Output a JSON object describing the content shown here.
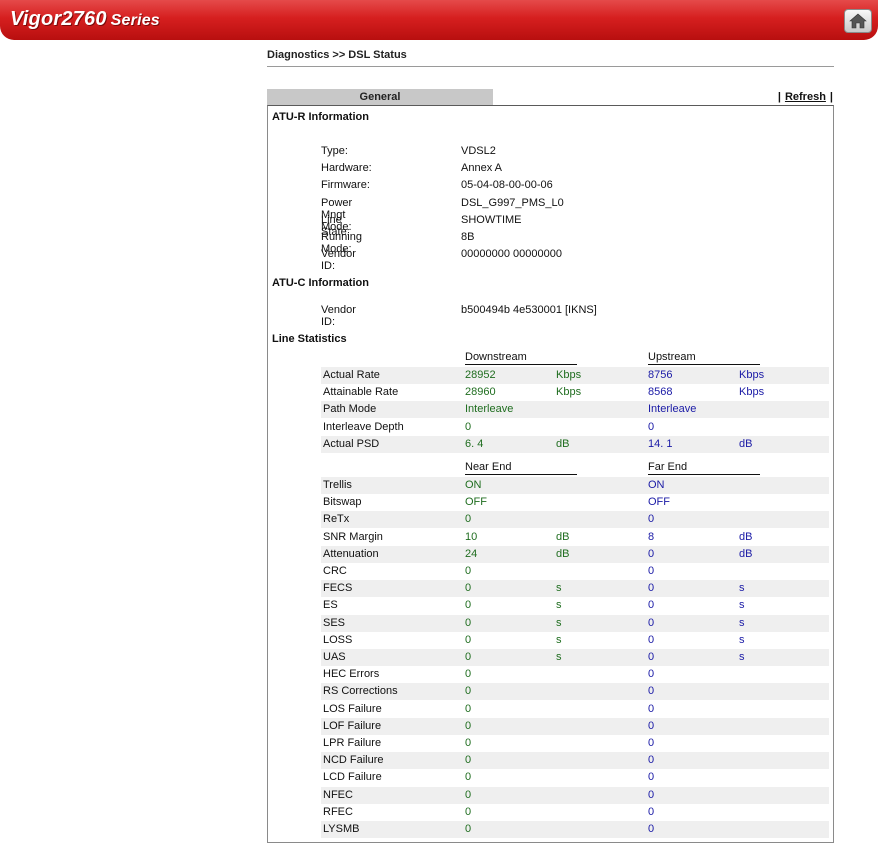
{
  "banner": {
    "model": "Vigor2760",
    "series": "Series"
  },
  "breadcrumb": "Diagnostics >> DSL Status",
  "tabs": {
    "general": "General"
  },
  "refresh": {
    "sep_left": "|",
    "label": "Refresh",
    "sep_right": "|"
  },
  "atur": {
    "title": "ATU-R Information",
    "rows": [
      {
        "label": "Type:",
        "value": "VDSL2"
      },
      {
        "label": "Hardware:",
        "value": "Annex A"
      },
      {
        "label": "Firmware:",
        "value": "05-04-08-00-00-06"
      },
      {
        "label": "Power Mngt Mode:",
        "value": "DSL_G997_PMS_L0"
      },
      {
        "label": "Line State:",
        "value": "SHOWTIME"
      },
      {
        "label": "Running Mode:",
        "value": "8B"
      },
      {
        "label": "Vendor ID:",
        "value": "00000000 00000000"
      }
    ]
  },
  "atuc": {
    "title": "ATU-C Information",
    "rows": [
      {
        "label": "Vendor ID:",
        "value": "b500494b 4e530001 [IKNS]"
      }
    ]
  },
  "line_stats": {
    "title": "Line Statistics",
    "group1": {
      "down_header": "Downstream",
      "up_header": "Upstream",
      "rows": [
        {
          "label": "Actual Rate",
          "dv": "28952",
          "du": "Kbps",
          "uv": "8756",
          "uu": "Kbps"
        },
        {
          "label": "Attainable Rate",
          "dv": "28960",
          "du": "Kbps",
          "uv": "8568",
          "uu": "Kbps"
        },
        {
          "label": "Path Mode",
          "dv": "Interleave",
          "du": "",
          "uv": "Interleave",
          "uu": ""
        },
        {
          "label": "Interleave Depth",
          "dv": "0",
          "du": "",
          "uv": "0",
          "uu": ""
        },
        {
          "label": "Actual PSD",
          "dv": "6. 4",
          "du": "dB",
          "uv": "14. 1",
          "uu": "dB"
        }
      ]
    },
    "group2": {
      "down_header": "Near End",
      "up_header": "Far End",
      "rows": [
        {
          "label": "Trellis",
          "dv": "ON",
          "du": "",
          "uv": "ON",
          "uu": ""
        },
        {
          "label": "Bitswap",
          "dv": "OFF",
          "du": "",
          "uv": "OFF",
          "uu": ""
        },
        {
          "label": "ReTx",
          "dv": "0",
          "du": "",
          "uv": "0",
          "uu": ""
        },
        {
          "label": "SNR Margin",
          "dv": "10",
          "du": "dB",
          "uv": "8",
          "uu": "dB"
        },
        {
          "label": "Attenuation",
          "dv": "24",
          "du": "dB",
          "uv": "0",
          "uu": "dB"
        },
        {
          "label": "CRC",
          "dv": "0",
          "du": "",
          "uv": "0",
          "uu": ""
        },
        {
          "label": "FECS",
          "dv": "0",
          "du": "s",
          "uv": "0",
          "uu": "s"
        },
        {
          "label": "ES",
          "dv": "0",
          "du": "s",
          "uv": "0",
          "uu": "s"
        },
        {
          "label": "SES",
          "dv": "0",
          "du": "s",
          "uv": "0",
          "uu": "s"
        },
        {
          "label": "LOSS",
          "dv": "0",
          "du": "s",
          "uv": "0",
          "uu": "s"
        },
        {
          "label": "UAS",
          "dv": "0",
          "du": "s",
          "uv": "0",
          "uu": "s"
        },
        {
          "label": "HEC Errors",
          "dv": "0",
          "du": "",
          "uv": "0",
          "uu": ""
        },
        {
          "label": "RS Corrections",
          "dv": "0",
          "du": "",
          "uv": "0",
          "uu": ""
        },
        {
          "label": "LOS Failure",
          "dv": "0",
          "du": "",
          "uv": "0",
          "uu": ""
        },
        {
          "label": "LOF Failure",
          "dv": "0",
          "du": "",
          "uv": "0",
          "uu": ""
        },
        {
          "label": "LPR Failure",
          "dv": "0",
          "du": "",
          "uv": "0",
          "uu": ""
        },
        {
          "label": "NCD Failure",
          "dv": "0",
          "du": "",
          "uv": "0",
          "uu": ""
        },
        {
          "label": "LCD Failure",
          "dv": "0",
          "du": "",
          "uv": "0",
          "uu": ""
        },
        {
          "label": "NFEC",
          "dv": "0",
          "du": "",
          "uv": "0",
          "uu": ""
        },
        {
          "label": "RFEC",
          "dv": "0",
          "du": "",
          "uv": "0",
          "uu": ""
        },
        {
          "label": "LYSMB",
          "dv": "0",
          "du": "",
          "uv": "0",
          "uu": ""
        }
      ]
    }
  },
  "colors": {
    "banner": "#d61f1f",
    "downstream_text": "#1f6d1f",
    "upstream_text": "#1a1aa6",
    "row_shade": "#efefef"
  }
}
